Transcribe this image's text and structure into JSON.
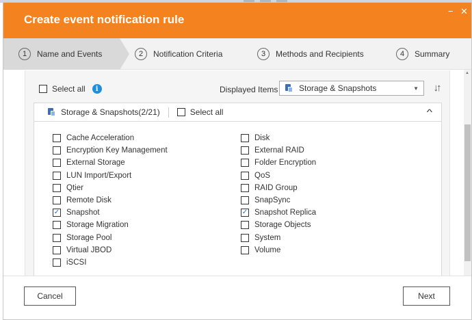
{
  "dialog": {
    "title": "Create event notification rule",
    "minimize_glyph": "−",
    "close_glyph": "✕"
  },
  "steps": [
    {
      "num": "1",
      "label": "Name and Events",
      "active": true
    },
    {
      "num": "2",
      "label": "Notification Criteria",
      "active": false
    },
    {
      "num": "3",
      "label": "Methods and Recipients",
      "active": false
    },
    {
      "num": "4",
      "label": "Summary",
      "active": false
    }
  ],
  "toolbar": {
    "select_all_label": "Select all",
    "select_all_checked": false,
    "info_glyph": "i",
    "displayed_items_label": "Displayed Items",
    "displayed_items_value": "Storage & Snapshots",
    "dropdown_arrow": "▼",
    "sort_glyph": "↓↑"
  },
  "group": {
    "title": "Storage & Snapshots(2/21)",
    "select_all_label": "Select all",
    "select_all_checked": false,
    "collapse_glyph": "^"
  },
  "items_left": [
    {
      "label": "Cache Acceleration",
      "checked": false
    },
    {
      "label": "Encryption Key Management",
      "checked": false
    },
    {
      "label": "External Storage",
      "checked": false
    },
    {
      "label": "LUN Import/Export",
      "checked": false
    },
    {
      "label": "Qtier",
      "checked": false
    },
    {
      "label": "Remote Disk",
      "checked": false
    },
    {
      "label": "Snapshot",
      "checked": true
    },
    {
      "label": "Storage Migration",
      "checked": false
    },
    {
      "label": "Storage Pool",
      "checked": false
    },
    {
      "label": "Virtual JBOD",
      "checked": false
    },
    {
      "label": "iSCSI",
      "checked": false
    }
  ],
  "items_right": [
    {
      "label": "Disk",
      "checked": false
    },
    {
      "label": "External RAID",
      "checked": false
    },
    {
      "label": "Folder Encryption",
      "checked": false
    },
    {
      "label": "QoS",
      "checked": false
    },
    {
      "label": "RAID Group",
      "checked": false
    },
    {
      "label": "SnapSync",
      "checked": false
    },
    {
      "label": "Snapshot Replica",
      "checked": true
    },
    {
      "label": "Storage Objects",
      "checked": false
    },
    {
      "label": "System",
      "checked": false
    },
    {
      "label": "Volume",
      "checked": false
    }
  ],
  "checkmark_glyph": "✓",
  "footer": {
    "cancel_label": "Cancel",
    "next_label": "Next"
  },
  "colors": {
    "title_bar": "#f4821f",
    "active_step": "#d9d9d9",
    "accent_blue": "#1e8fe0"
  }
}
